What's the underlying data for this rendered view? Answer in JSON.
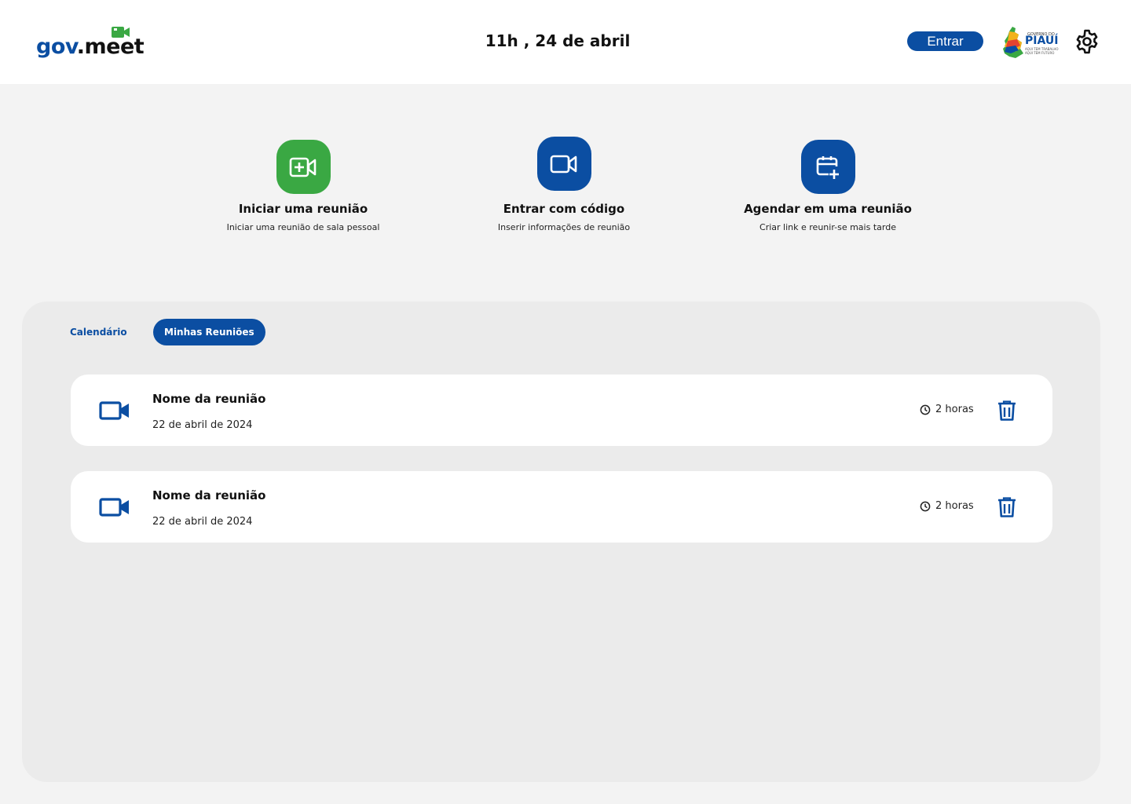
{
  "header": {
    "logo_gov": "gov",
    "logo_meet": ".meet",
    "datetime": "11h , 24 de abril",
    "login_label": "Entrar",
    "gov_logo": {
      "top": "GOVERNO DO",
      "name": "PIAUÍ",
      "sub1": "AQUI TEM TRABALHO",
      "sub2": "AQUI TEM FUTURO"
    },
    "settings_icon": "gear-icon"
  },
  "actions": [
    {
      "icon": "video-plus-icon",
      "color": "#3aa843",
      "title": "Iniciar uma reunião",
      "subtitle": "Iniciar uma reunião de sala pessoal"
    },
    {
      "icon": "video-icon",
      "color": "#0b4ea2",
      "title": "Entrar com código",
      "subtitle": "Inserir informações de reunião"
    },
    {
      "icon": "calendar-plus-icon",
      "color": "#0b4ea2",
      "title": "Agendar em uma reunião",
      "subtitle": "Criar link e reunir-se mais tarde"
    }
  ],
  "tabs": {
    "calendar": "Calendário",
    "mine": "Minhas Reuniões",
    "active": "mine"
  },
  "meetings": [
    {
      "title": "Nome da reunião",
      "date": "22 de abril de 2024",
      "duration": "2 horas"
    },
    {
      "title": "Nome da reunião",
      "date": "22 de abril de 2024",
      "duration": "2 horas"
    }
  ],
  "colors": {
    "primary": "#0b4ea2",
    "green": "#3aa843",
    "panel": "#ebebeb",
    "background": "#f3f3f3"
  }
}
